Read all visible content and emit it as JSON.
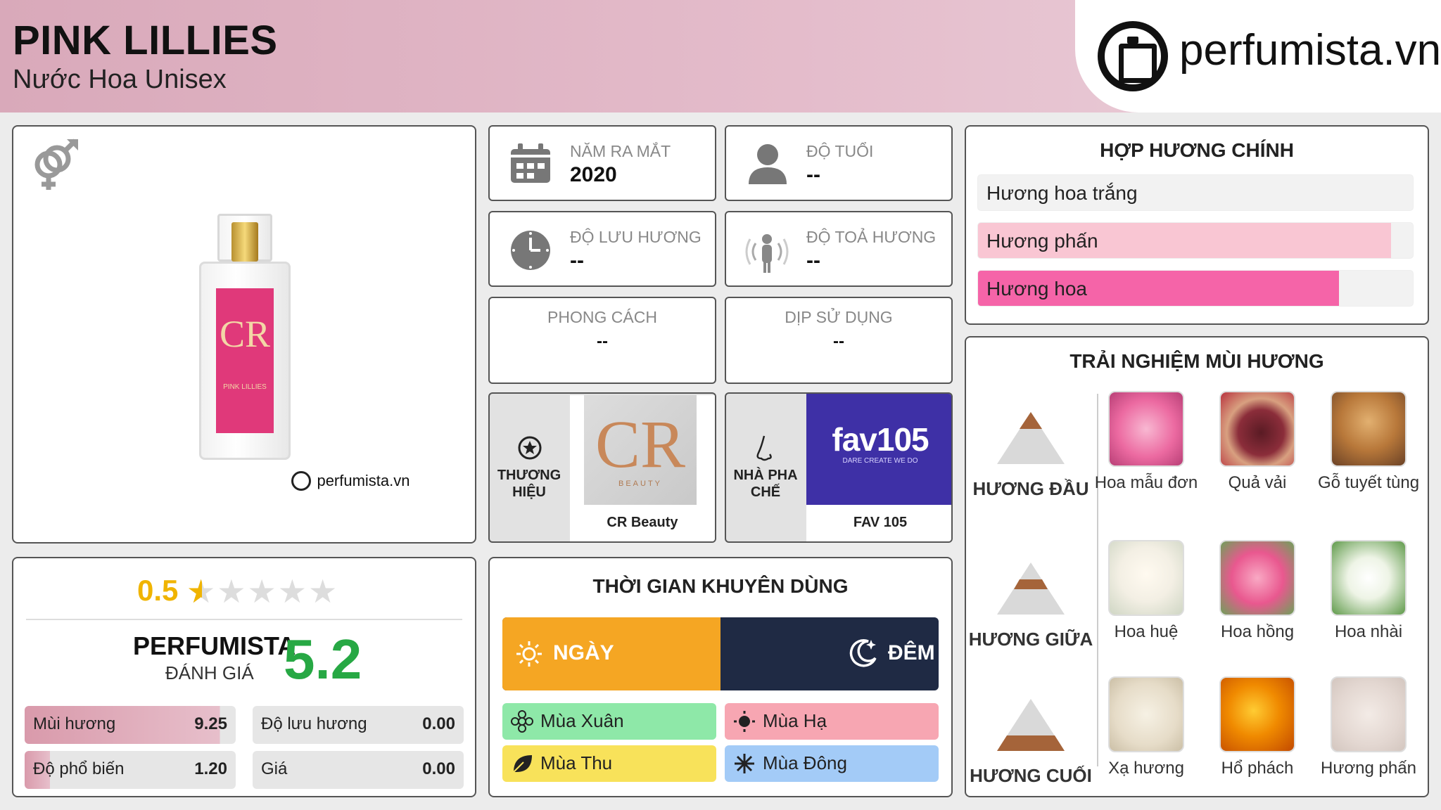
{
  "header": {
    "title": "PINK LILLIES",
    "subtitle": "Nước Hoa Unisex",
    "logo_text": "perfumista.vn"
  },
  "product": {
    "gender_icon": "unisex-gender-icon",
    "bottle_brand_mark": "CR",
    "bottle_label": "PINK LILLIES",
    "watermark": "perfumista.vn"
  },
  "info": {
    "launch_year": {
      "label": "NĂM RA MẮT",
      "value": "2020",
      "icon": "calendar-icon"
    },
    "age": {
      "label": "ĐỘ TUỔI",
      "value": "--",
      "icon": "person-icon"
    },
    "longevity": {
      "label": "ĐỘ LƯU HƯƠNG",
      "value": "--",
      "icon": "clock-icon"
    },
    "sillage": {
      "label": "ĐỘ TOẢ HƯƠNG",
      "value": "--",
      "icon": "radiate-icon"
    },
    "style": {
      "label": "PHONG CÁCH",
      "value": "--"
    },
    "occasion": {
      "label": "DỊP SỬ DỤNG",
      "value": "--"
    },
    "brand": {
      "label": "THƯƠNG HIỆU",
      "name": "CR Beauty",
      "logo_text": "CR",
      "logo_sub": "BEAUTY",
      "icon": "star-badge-icon"
    },
    "perfumer": {
      "label": "NHÀ PHA CHẾ",
      "name": "FAV 105",
      "logo_text": "fav105",
      "logo_sub": "DARE CREATE WE DO",
      "icon": "nose-icon"
    }
  },
  "accords": {
    "title": "HỢP HƯƠNG CHÍNH",
    "items": [
      {
        "label": "Hương hoa trắng",
        "percent": 0,
        "color": "#ffffff"
      },
      {
        "label": "Hương phấn",
        "percent": 95,
        "color": "#f9c6d3"
      },
      {
        "label": "Hương hoa",
        "percent": 83,
        "color": "#f564a8"
      }
    ]
  },
  "notes": {
    "title": "TRẢI NGHIỆM MÙI HƯƠNG",
    "top": {
      "label": "HƯƠNG ĐẦU",
      "items": [
        "Hoa mẫu đơn",
        "Quả vải",
        "Gỗ tuyết tùng"
      ]
    },
    "middle": {
      "label": "HƯƠNG GIỮA",
      "items": [
        "Hoa huệ",
        "Hoa hồng",
        "Hoa nhài"
      ]
    },
    "base": {
      "label": "HƯƠNG CUỐI",
      "items": [
        "Xạ hương",
        "Hổ phách",
        "Hương phấn"
      ]
    }
  },
  "rating": {
    "user_score": "0.5",
    "stars_filled_fraction": 0.1,
    "perfumista_label": "PERFUMISTA",
    "perfumista_sub": "ĐÁNH GIÁ",
    "perfumista_score": "5.2",
    "metrics": [
      {
        "label": "Mùi hương",
        "value": "9.25",
        "percent": 92.5
      },
      {
        "label": "Độ lưu hương",
        "value": "0.00",
        "percent": 0
      },
      {
        "label": "Độ phổ biến",
        "value": "1.20",
        "percent": 12
      },
      {
        "label": "Giá",
        "value": "0.00",
        "percent": 0
      }
    ]
  },
  "time": {
    "title": "THỜI GIAN KHUYÊN DÙNG",
    "day_label": "NGÀY",
    "night_label": "ĐÊM",
    "day_percent": 50,
    "day_color": "#f5a623",
    "night_color": "#1f2a44",
    "seasons": [
      {
        "label": "Mùa Xuân",
        "color": "#8ee8a8",
        "icon": "flower-icon"
      },
      {
        "label": "Mùa Hạ",
        "color": "#f7a6b2",
        "icon": "sun-icon"
      },
      {
        "label": "Mùa Thu",
        "color": "#f8e25a",
        "icon": "leaf-icon"
      },
      {
        "label": "Mùa Đông",
        "color": "#a3cbf7",
        "icon": "snowflake-icon"
      }
    ]
  }
}
